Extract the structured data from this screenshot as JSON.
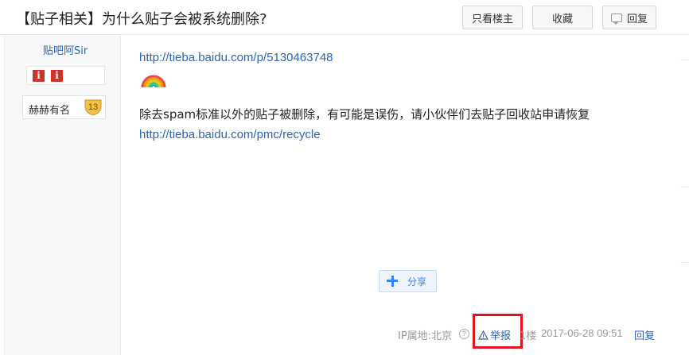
{
  "header": {
    "title": "【贴子相关】为什么贴子会被系统删除?",
    "only_author_label": "只看楼主",
    "favorite_label": "收藏",
    "reply_label": "回复"
  },
  "author": {
    "name": "贴吧阿Sir",
    "badges": [
      "i",
      "i"
    ],
    "level_title": "赫赫有名",
    "level": "13"
  },
  "post": {
    "link1": "http://tieba.baidu.com/p/5130463748",
    "emoji": "rainbow",
    "paragraph": "除去spam标准以外的贴子被删除，有可能是误伤，请小伙伴们去贴子回收站申请恢复",
    "link2": "http://tieba.baidu.com/pmc/recycle",
    "share_label": "分享"
  },
  "footer": {
    "ip_location": "IP属地:北京",
    "help_icon": "?",
    "report_label": "举报",
    "floor": "1楼",
    "datetime": "2017-06-28 09:51",
    "reply_label": "回复"
  },
  "colors": {
    "link": "#2d64b3",
    "highlight": "#e0141e",
    "badge": "#d1322a",
    "share": "#3385ff"
  }
}
